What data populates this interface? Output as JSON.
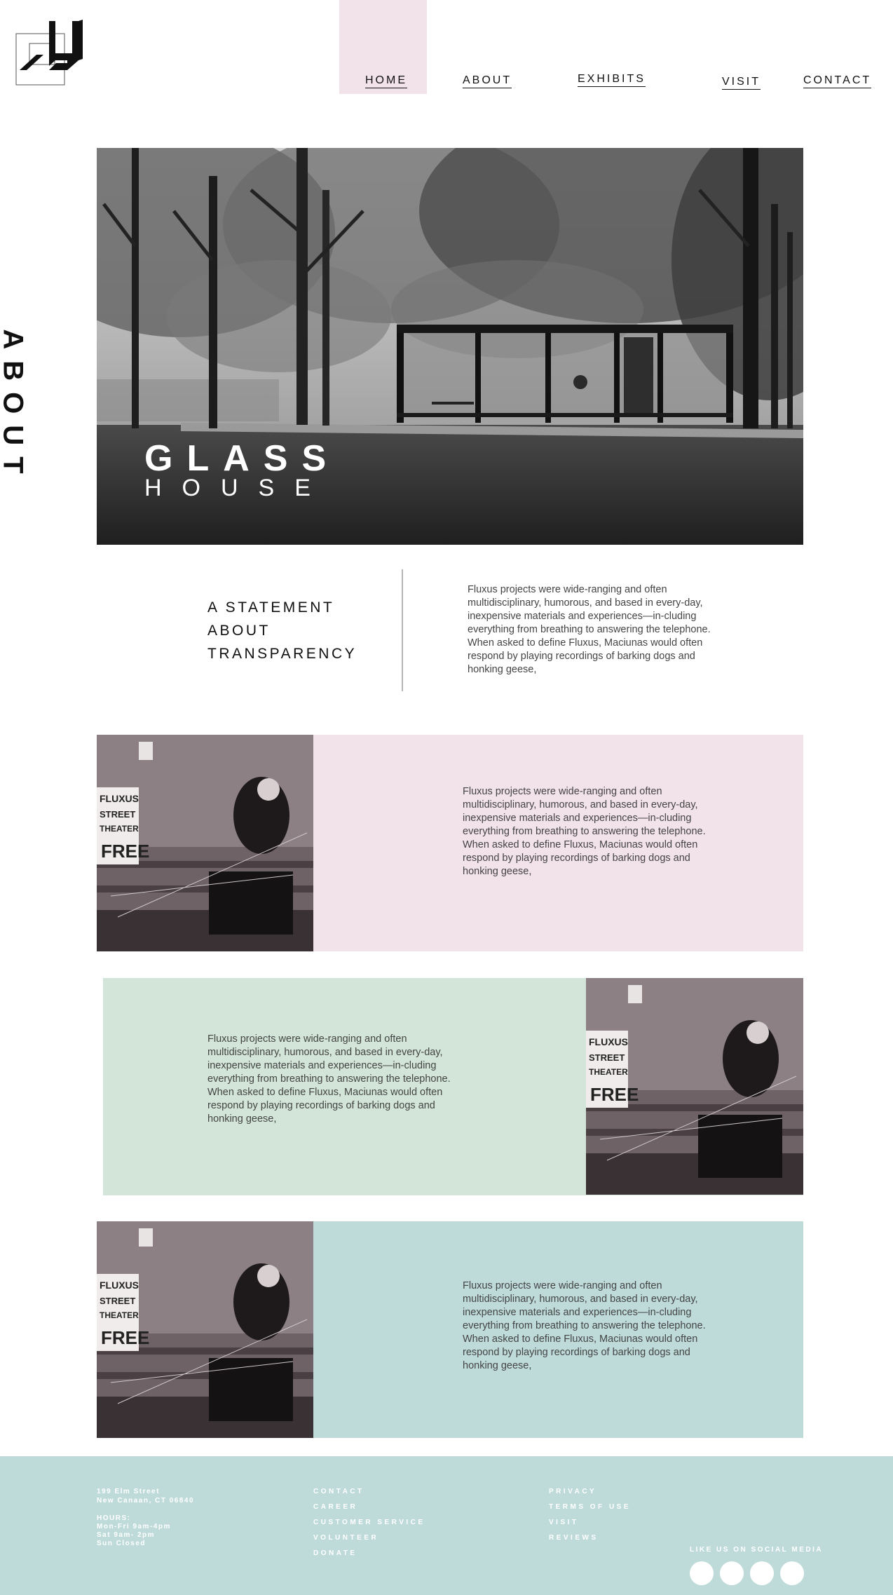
{
  "nav": {
    "items": [
      {
        "label": "HOME"
      },
      {
        "label": "ABOUT"
      },
      {
        "label": "EXHIBITS"
      },
      {
        "label": "VISIT"
      },
      {
        "label": "CONTACT"
      }
    ],
    "active": "HOME"
  },
  "side_label": "ABOUT",
  "hero": {
    "title_line1": "GLASS",
    "title_line2": "HOUSE"
  },
  "statement": {
    "heading_lines": [
      "A STATEMENT",
      "ABOUT",
      "TRANSPARENCY"
    ],
    "text": "Fluxus projects were wide-ranging and often multidisciplinary, humorous, and based in every-day, inexpensive materials and experiences—in-cluding everything from breathing to answering the telephone. When asked to define Fluxus, Maciunas would often respond by playing recordings of barking dogs and honking geese,"
  },
  "blocks": [
    {
      "text": "Fluxus projects were wide-ranging and often multidisciplinary, humorous, and based in every-day, inexpensive materials and experiences—in-cluding everything from breathing to answering the telephone. When asked to define Fluxus, Maciunas would often respond by playing recordings of barking dogs and honking geese,",
      "bg_color": "#f2e2e9",
      "sign_lines": [
        "FLUXUS",
        "STREET",
        "THEATER",
        "FREE"
      ]
    },
    {
      "text": "Fluxus projects were wide-ranging and often multidisciplinary, humorous, and based in every-day, inexpensive materials and experiences—in-cluding everything from breathing to answering the telephone. When asked to define Fluxus, Maciunas would often respond by playing recordings of barking dogs and honking geese,",
      "bg_color": "#d2e5d8",
      "sign_lines": [
        "FLUXUS",
        "STREET",
        "THEATER",
        "FREE"
      ]
    },
    {
      "text": "Fluxus projects were wide-ranging and often multidisciplinary, humorous, and based in every-day, inexpensive materials and experiences—in-cluding everything from breathing to answering the telephone. When asked to define Fluxus, Maciunas would often respond by playing recordings of barking dogs and honking geese,",
      "bg_color": "#bedbda",
      "sign_lines": [
        "FLUXUS",
        "STREET",
        "THEATER",
        "FREE"
      ]
    }
  ],
  "footer": {
    "bg_color": "#bedbda",
    "address_line1": "199 Elm Street",
    "address_line2": "New Canaan, CT 06840",
    "hours_label": "HOURS:",
    "hours_line1": "Mon-Fri 9am-4pm",
    "hours_line2": "Sat 9am- 2pm",
    "hours_line3": "Sun Closed",
    "links_col1": [
      "CONTACT",
      "CAREER",
      "CUSTOMER SERVICE",
      "VOLUNTEER",
      "DONATE"
    ],
    "links_col2": [
      "PRIVACY",
      "TERMS OF USE",
      "VISIT",
      "REVIEWS"
    ],
    "social_label": "LIKE US ON SOCIAL MEDIA",
    "social_icons": [
      "social-icon-1",
      "social-icon-2",
      "social-icon-3",
      "social-icon-4"
    ]
  },
  "colors": {
    "accent_pink": "#f2e2e9",
    "accent_green": "#d2e5d8",
    "accent_teal": "#bedbda"
  }
}
